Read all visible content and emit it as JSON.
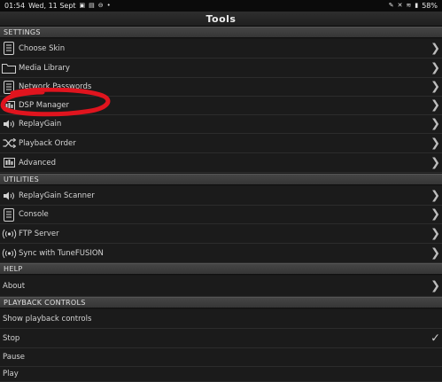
{
  "status_bar": {
    "time": "01:54",
    "date": "Wed, 11 Sept",
    "battery": "58%",
    "left_icons": [
      "gallery-icon",
      "message-icon",
      "blocked-icon",
      "dot-icon"
    ],
    "right_icons": [
      "pen-icon",
      "mute-icon",
      "wifi-icon",
      "battery-icon"
    ]
  },
  "title": "Tools",
  "sections": {
    "settings": "SETTINGS",
    "utilities": "UTILITIES",
    "help": "HELP",
    "playback_controls": "PLAYBACK CONTROLS"
  },
  "settings_items": [
    {
      "label": "Choose Skin",
      "icon": "list-icon"
    },
    {
      "label": "Media Library",
      "icon": "folder-icon"
    },
    {
      "label": "Network Passwords",
      "icon": "list-icon"
    },
    {
      "label": "DSP Manager",
      "icon": "equalizer-icon"
    },
    {
      "label": "ReplayGain",
      "icon": "speaker-icon"
    },
    {
      "label": "Playback Order",
      "icon": "shuffle-icon"
    },
    {
      "label": "Advanced",
      "icon": "equalizer-icon"
    }
  ],
  "utilities_items": [
    {
      "label": "ReplayGain Scanner",
      "icon": "speaker-icon"
    },
    {
      "label": "Console",
      "icon": "list-icon"
    },
    {
      "label": "FTP Server",
      "icon": "broadcast-icon"
    },
    {
      "label": "Sync with TuneFUSION",
      "icon": "broadcast-icon"
    }
  ],
  "help_items": [
    {
      "label": "About"
    }
  ],
  "playback_items": [
    {
      "label": "Show playback controls",
      "checked": false
    },
    {
      "label": "Stop",
      "checked": true
    },
    {
      "label": "Pause",
      "checked": false
    },
    {
      "label": "Play",
      "checked": false
    }
  ],
  "annotation_color": "#e0141e"
}
